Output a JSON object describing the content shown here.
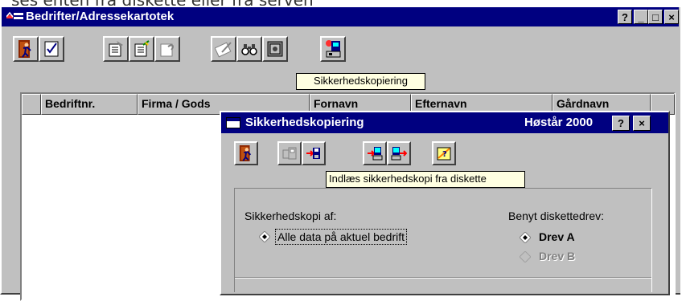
{
  "top_caption": "ses enten fra diskette eller fra serven",
  "main_window": {
    "title": "Bedrifter/Adressekartotek",
    "caption_buttons": {
      "help": "?",
      "minimize": "_",
      "maximize": "□",
      "close": "×"
    },
    "toolbar": {
      "buttons": [
        {
          "name": "exit-icon"
        },
        {
          "name": "checklist-icon"
        },
        {
          "name": "document-new-icon"
        },
        {
          "name": "document-edit-icon"
        },
        {
          "name": "document-delete-icon"
        },
        {
          "name": "write-icon"
        },
        {
          "name": "binoculars-icon"
        },
        {
          "name": "safe-icon"
        },
        {
          "name": "backup-icon"
        }
      ],
      "tooltip": "Sikkerhedskopiering"
    },
    "table": {
      "columns": [
        "Bedriftnr.",
        "Firma / Gods",
        "Fornavn",
        "Efternavn",
        "Gårdnavn"
      ]
    }
  },
  "dialog": {
    "title": "Sikkerhedskopiering",
    "subtitle": "Høstår 2000",
    "caption_buttons": {
      "help": "?",
      "close": "×"
    },
    "toolbar": {
      "buttons": [
        {
          "name": "exit-icon"
        },
        {
          "name": "save-to-disk-disabled-icon"
        },
        {
          "name": "load-from-disk-icon"
        },
        {
          "name": "export-to-server-icon"
        },
        {
          "name": "import-from-server-icon"
        },
        {
          "name": "help-book-icon"
        }
      ],
      "tooltip": "Indlæs sikkerhedskopi fra diskette"
    },
    "backup_of": {
      "label": "Sikkerhedskopi af:",
      "option": "Alle data på aktuel bedrift"
    },
    "drive": {
      "label": "Benyt diskettedrev:",
      "options": [
        {
          "label": "Drev A",
          "selected": true,
          "enabled": true
        },
        {
          "label": "Drev B",
          "selected": false,
          "enabled": false
        }
      ]
    }
  }
}
